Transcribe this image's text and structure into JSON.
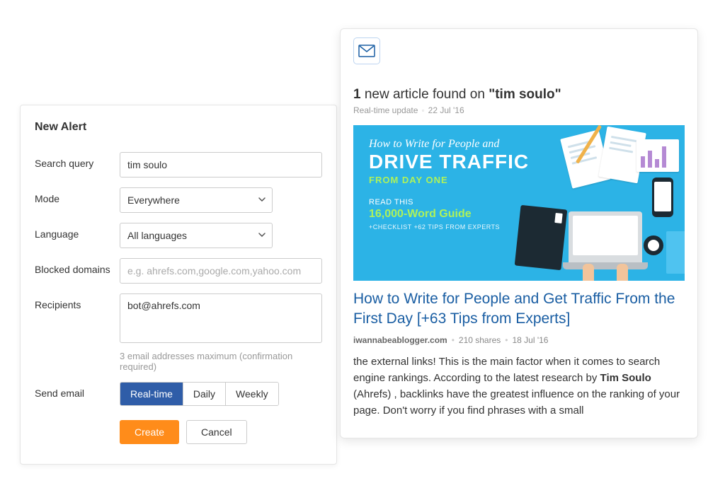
{
  "left": {
    "title": "New Alert",
    "labels": {
      "search_query": "Search query",
      "mode": "Mode",
      "language": "Language",
      "blocked_domains": "Blocked domains",
      "recipients": "Recipients",
      "send_email": "Send email"
    },
    "values": {
      "search_query": "tim soulo",
      "mode_selected": "Everywhere",
      "language_selected": "All languages",
      "blocked_placeholder": "e.g. ahrefs.com,google.com,yahoo.com",
      "recipients": "bot@ahrefs.com"
    },
    "hints": {
      "recipients": "3 email addresses maximum (confirmation required)"
    },
    "send_options": [
      "Real-time",
      "Daily",
      "Weekly"
    ],
    "send_selected": "Real-time",
    "buttons": {
      "create": "Create",
      "cancel": "Cancel"
    }
  },
  "right": {
    "headline": {
      "count": "1",
      "mid": " new article found on ",
      "quoted": "\"tim soulo\""
    },
    "meta": {
      "type": "Real-time update",
      "date": "22 Jul '16"
    },
    "hero": {
      "line1": "How to Write for People and",
      "big": "DRIVE TRAFFIC",
      "sub": "FROM DAY ONE",
      "readthis": "READ THIS",
      "guide": "16,000-Word Guide",
      "tips": "+CHECKLIST +62 TIPS FROM EXPERTS"
    },
    "article": {
      "title": "How to Write for People and Get Traffic From the First Day [+63 Tips from Experts]",
      "site": "iwannabeablogger.com",
      "shares": "210 shares",
      "date": "18 Jul '16",
      "snippet_pre": "the external links! This is the main factor when it comes to search engine rankings. According to the latest research by ",
      "snippet_hl": "Tim Soulo",
      "snippet_post": " (Ahrefs) , backlinks have the greatest influence on the ranking of your page. Don't worry if you find phrases with a small"
    }
  }
}
